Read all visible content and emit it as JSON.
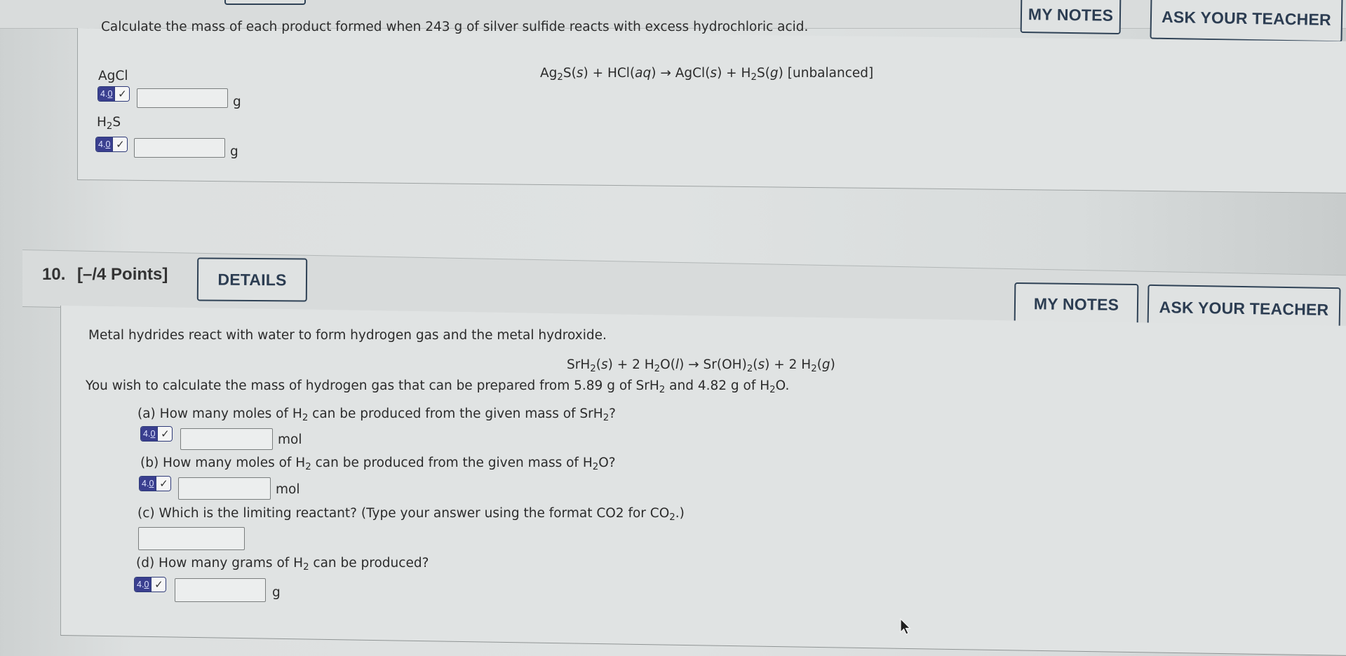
{
  "previous_question": {
    "header_buttons": {
      "my_notes": "MY NOTES",
      "ask_teacher": "ASK YOUR TEACHER"
    },
    "prompt": "Calculate the mass of each product formed when 243 g of silver sulfide reacts with excess hydrochloric acid.",
    "equation": {
      "reactant1": "Ag",
      "reactant1_sub": "2",
      "reactant1_rest": "S(",
      "reactant1_state": "s",
      "plus1": ") + HCl(",
      "reactant2_state": "aq",
      "arrow": ") → AgCl(",
      "product1_state": "s",
      "plus2": ") + H",
      "product2_sub": "2",
      "product2_rest": "S(",
      "product2_state": "g",
      "tail": ") [unbalanced]"
    },
    "answers": [
      {
        "label_main": "AgCl",
        "label_sub": "",
        "label_rest": "",
        "badge_value_int": "4.",
        "badge_value_dec": "0",
        "value": "",
        "unit": "g"
      },
      {
        "label_main": "H",
        "label_sub": "2",
        "label_rest": "S",
        "badge_value_int": "4.",
        "badge_value_dec": "0",
        "value": "",
        "unit": "g"
      }
    ]
  },
  "question": {
    "number": "10.",
    "points": "[–/4 Points]",
    "details_button": "DETAILS",
    "my_notes_button": "MY NOTES",
    "ask_teacher_button": "ASK YOUR TEACHER",
    "intro": "Metal hydrides react with water to form hydrogen gas and the metal hydroxide.",
    "equation": {
      "p1": "SrH",
      "p1_sub": "2",
      "p2": "(",
      "p2_state": "s",
      "p3": ") + 2 H",
      "p3_sub": "2",
      "p4": "O(",
      "p4_state": "l",
      "p5": ") → Sr(OH)",
      "p5_sub": "2",
      "p6": "(",
      "p6_state": "s",
      "p7": ") + 2 H",
      "p7_sub": "2",
      "p8": "(",
      "p8_state": "g",
      "p9": ")"
    },
    "task": {
      "t1": "You wish to calculate the mass of hydrogen gas that can be prepared from 5.89 g of SrH",
      "t1_sub": "2",
      "t2": " and 4.82 g of H",
      "t2_sub": "2",
      "t3": "O."
    },
    "parts": [
      {
        "q1": "(a) How many moles of H",
        "q1_sub": "2",
        "q2": " can be produced from the given mass of SrH",
        "q2_sub": "2",
        "q3": "?",
        "badge_value_int": "4.",
        "badge_value_dec": "0",
        "value": "",
        "unit": "mol"
      },
      {
        "q1": "(b) How many moles of H",
        "q1_sub": "2",
        "q2": " can be produced from the given mass of H",
        "q2_sub": "2",
        "q3": "O?",
        "badge_value_int": "4.",
        "badge_value_dec": "0",
        "value": "",
        "unit": "mol"
      },
      {
        "q1": "(c) Which is the limiting reactant? (Type your answer using the format CO2 for CO",
        "q1_sub": "2",
        "q2": ".)",
        "q2_sub": "",
        "q3": "",
        "value": "",
        "unit": ""
      },
      {
        "q1": "(d) How many grams of H",
        "q1_sub": "2",
        "q2": " can be produced?",
        "q2_sub": "",
        "q3": "",
        "badge_value_int": "4.",
        "badge_value_dec": "0",
        "value": "",
        "unit": "g"
      }
    ]
  },
  "icons": {
    "check": "✓"
  },
  "colors": {
    "button_border": "#2f4256",
    "button_text": "#2c3d52",
    "badge_bg": "#3a3f8f",
    "page_bg": "#dfe2e2"
  }
}
